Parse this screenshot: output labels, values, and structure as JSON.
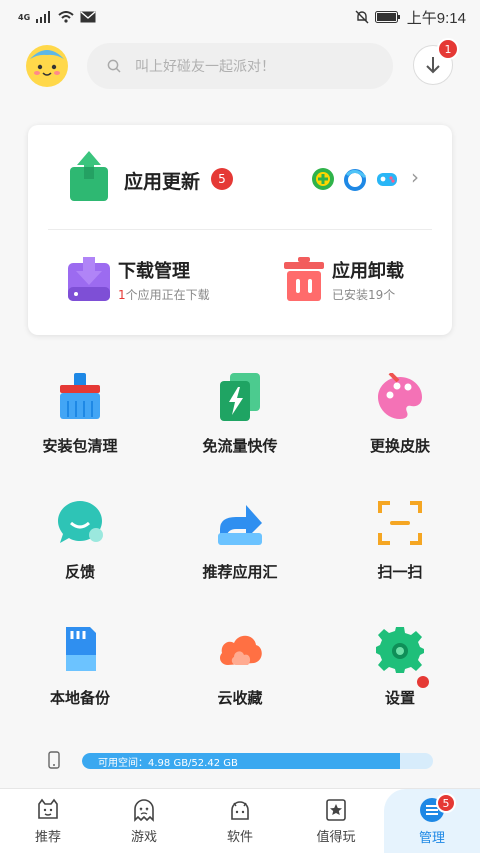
{
  "status_bar": {
    "network": "4G",
    "time": "上午9:14"
  },
  "header": {
    "search_placeholder": "叫上好碰友一起派对！",
    "download_badge": "1"
  },
  "card": {
    "update": {
      "title": "应用更新",
      "badge": "5"
    },
    "download_manager": {
      "title": "下载管理",
      "count": "1",
      "subtitle": "个应用正在下载"
    },
    "uninstall": {
      "title": "应用卸载",
      "subtitle": "已安装19个"
    }
  },
  "grid": [
    {
      "label": "安装包清理",
      "icon": "broom-icon"
    },
    {
      "label": "免流量快传",
      "icon": "flash-transfer-icon"
    },
    {
      "label": "更换皮肤",
      "icon": "palette-icon"
    },
    {
      "label": "反馈",
      "icon": "feedback-chat-icon"
    },
    {
      "label": "推荐应用汇",
      "icon": "share-arrow-icon"
    },
    {
      "label": "扫一扫",
      "icon": "scan-icon"
    },
    {
      "label": "本地备份",
      "icon": "sd-card-icon"
    },
    {
      "label": "云收藏",
      "icon": "cloud-icon"
    },
    {
      "label": "设置",
      "icon": "gear-icon"
    }
  ],
  "storage": {
    "text": "可用空间：4.98 GB/52.42 GB",
    "available_gb": 4.98,
    "total_gb": 52.42,
    "used_fraction": 0.905
  },
  "bottom_nav": [
    {
      "label": "推荐",
      "icon": "recommend-face-icon"
    },
    {
      "label": "游戏",
      "icon": "game-ghost-icon"
    },
    {
      "label": "软件",
      "icon": "android-icon"
    },
    {
      "label": "值得玩",
      "icon": "star-bookmark-icon"
    },
    {
      "label": "管理",
      "icon": "manage-icon",
      "badge": "5",
      "active": true
    }
  ],
  "colors": {
    "accent": "#1e88e5",
    "badge": "#e53935",
    "storage_fill": "#3aa8f0"
  }
}
